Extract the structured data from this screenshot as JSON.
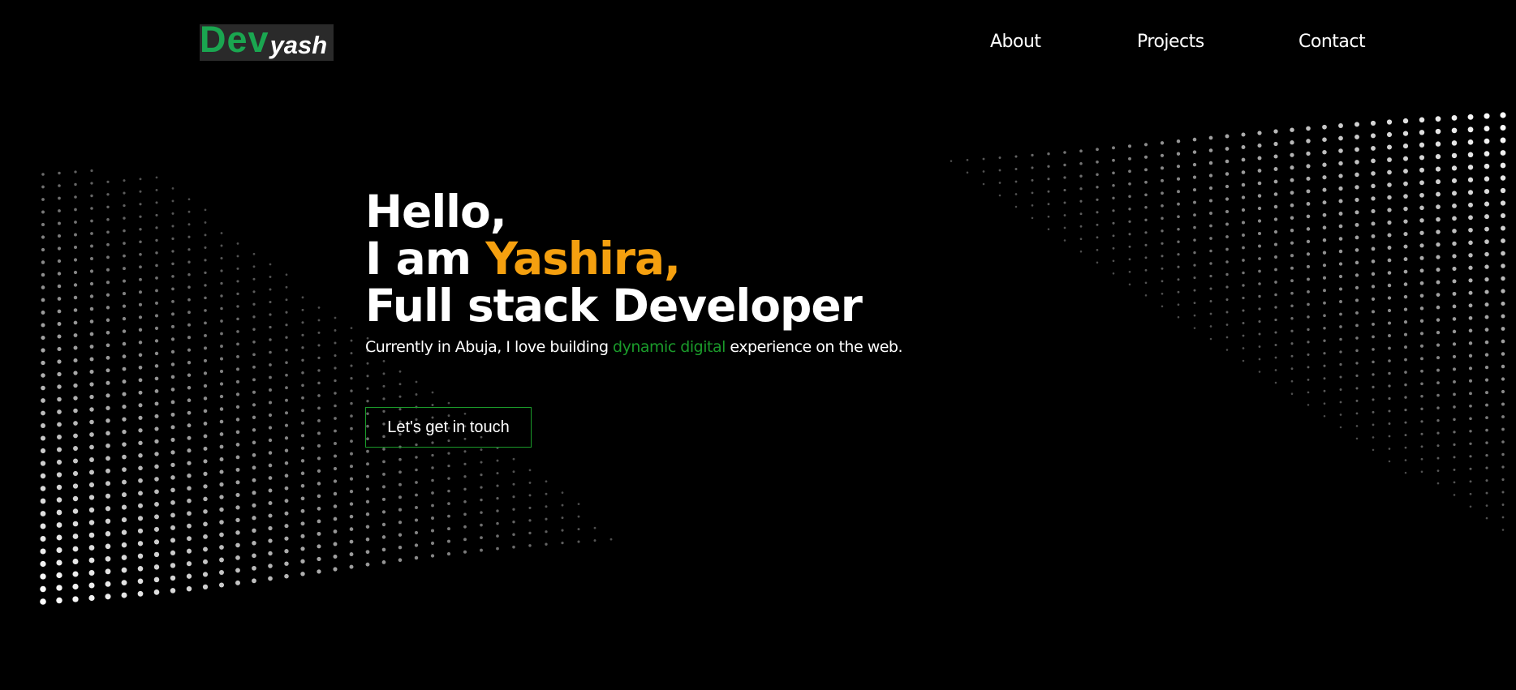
{
  "colors": {
    "background": "#000000",
    "logo_primary": "#1aa650",
    "logo_secondary": "#ffffff",
    "logo_background": "#2a2a2a",
    "name_highlight": "#f5a00f",
    "accent_green": "#1a9a2a",
    "text": "#ffffff"
  },
  "logo": {
    "primary": "Dev",
    "secondary": "yash"
  },
  "nav": {
    "items": [
      {
        "label": "About"
      },
      {
        "label": "Projects"
      },
      {
        "label": "Contact"
      }
    ]
  },
  "hero": {
    "greeting": "Hello,",
    "intro_prefix": "I am ",
    "name": "Yashira,",
    "role": "Full stack Developer",
    "subtitle_before": "Currently in Abuja, I love building ",
    "subtitle_highlight": "dynamic digital",
    "subtitle_after": " experience on the web.",
    "cta_label": "Let's get in touch"
  }
}
